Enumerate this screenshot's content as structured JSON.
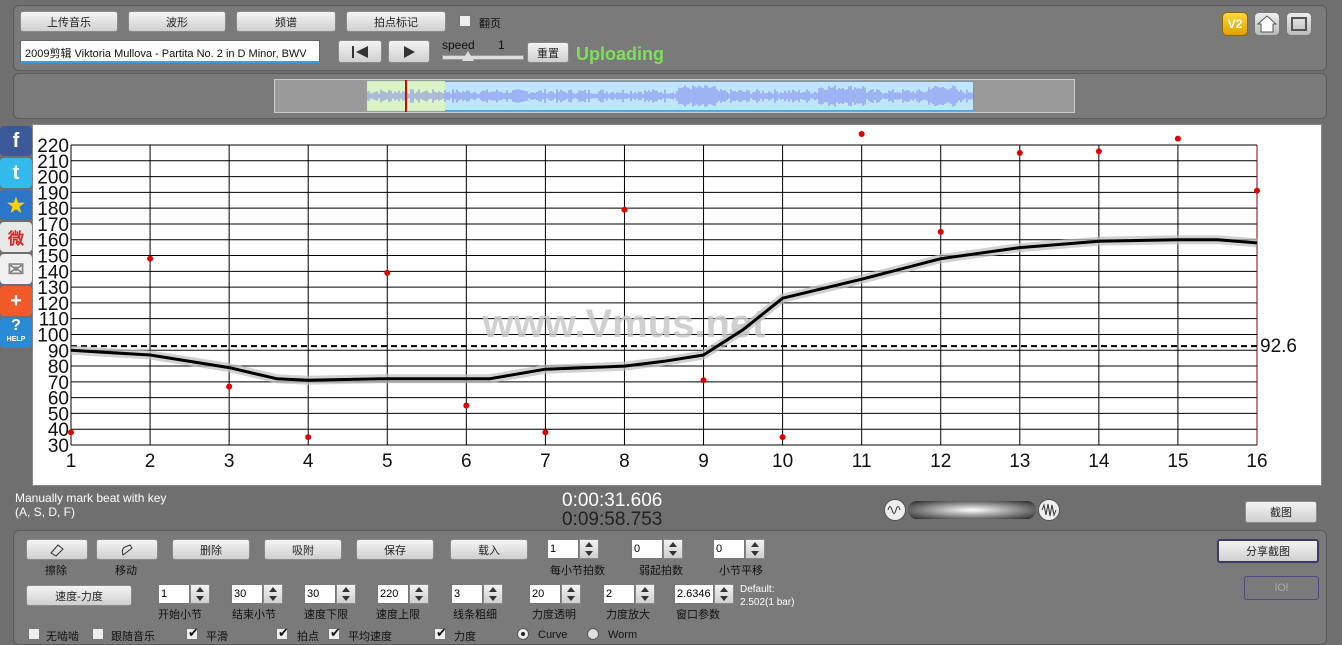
{
  "toolbar": {
    "upload_label": "上传音乐",
    "waveform_label": "波形",
    "spectrum_label": "频谱",
    "beatmark_label": "拍点标记",
    "pageflip_label": "翻页",
    "track_title": "2009剪辑 Viktoria Mullova - Partita No. 2 in D Minor, BWV",
    "speed_label": "speed",
    "speed_value": "1",
    "reset_label": "重置",
    "status_text": "Uploading",
    "v2_badge": "V2"
  },
  "side_share": [
    "f",
    "t",
    "★",
    "微",
    "✉",
    "+",
    "?"
  ],
  "side_help_text": "HELP",
  "chart_data": {
    "type": "line",
    "watermark": "www.Vmus.net",
    "xlim": [
      1,
      16
    ],
    "ylim": [
      30,
      220
    ],
    "x_ticks": [
      "1",
      "2",
      "3",
      "4",
      "5",
      "6",
      "7",
      "8",
      "9",
      "10",
      "11",
      "12",
      "13",
      "14",
      "15",
      "16"
    ],
    "y_ticks": [
      "30",
      "40",
      "50",
      "60",
      "70",
      "80",
      "90",
      "100",
      "110",
      "120",
      "130",
      "140",
      "150",
      "160",
      "170",
      "180",
      "190",
      "200",
      "210",
      "220"
    ],
    "average_value": 92.6,
    "average_label": "92.6",
    "series": [
      {
        "points": [
          [
            1,
            90
          ],
          [
            2,
            87
          ],
          [
            3,
            79
          ],
          [
            3.6,
            72
          ],
          [
            4,
            71
          ],
          [
            5,
            72
          ],
          [
            6,
            72
          ],
          [
            6.3,
            72
          ],
          [
            7,
            78
          ],
          [
            8,
            80
          ],
          [
            8.5,
            83
          ],
          [
            9,
            87
          ],
          [
            9.5,
            103
          ],
          [
            10,
            123
          ],
          [
            11,
            135
          ],
          [
            12,
            148
          ],
          [
            13,
            155
          ],
          [
            14,
            159
          ],
          [
            15,
            160
          ],
          [
            15.5,
            160
          ],
          [
            16,
            158
          ]
        ]
      }
    ],
    "beat_points": [
      [
        1,
        38
      ],
      [
        2,
        148
      ],
      [
        3,
        67
      ],
      [
        4,
        35
      ],
      [
        5,
        139
      ],
      [
        6,
        55
      ],
      [
        7,
        38
      ],
      [
        8,
        179
      ],
      [
        9,
        71
      ],
      [
        10,
        35
      ],
      [
        11,
        227
      ],
      [
        12,
        165
      ],
      [
        13,
        215
      ],
      [
        14,
        216
      ],
      [
        15,
        224
      ],
      [
        16,
        191
      ]
    ]
  },
  "info": {
    "hint_line1": "Manually mark beat with key",
    "hint_line2": "(A, S, D, F)",
    "time_current": "0:00:31.606",
    "time_total": "0:09:58.753",
    "screenshot_label": "截图"
  },
  "controls": {
    "erase_label": "擦除",
    "move_label": "移动",
    "delete_label": "删除",
    "snap_label": "吸附",
    "save_label": "保存",
    "load_label": "载入",
    "beats_per_bar": {
      "label": "每小节拍数",
      "value": "1"
    },
    "weak_beats": {
      "label": "弱起拍数",
      "value": "0"
    },
    "bar_offset": {
      "label": "小节平移",
      "value": "0"
    },
    "share_label": "分享截图",
    "disabled_label": "lOl",
    "tempo_dynamics_label": "速度-力度",
    "start_bar": {
      "label": "开始小节",
      "value": "1"
    },
    "end_bar": {
      "label": "结束小节",
      "value": "30"
    },
    "tempo_lower": {
      "label": "速度下限",
      "value": "30"
    },
    "tempo_upper": {
      "label": "速度上限",
      "value": "220"
    },
    "line_width": {
      "label": "线条粗细",
      "value": "3"
    },
    "dyn_opacity": {
      "label": "力度透明",
      "value": "20"
    },
    "dyn_scale": {
      "label": "力度放大",
      "value": "2"
    },
    "window_param": {
      "label": "窗口参数",
      "value": "2.6346"
    },
    "default_line1": "Default:",
    "default_line2": "2.502(1 bar)",
    "cb_nowrite": "无啮啮",
    "cb_follow": "跟随音乐",
    "cb_smooth": "平滑",
    "cb_beat": "拍点",
    "cb_avg": "平均速度",
    "cb_dyn": "力度",
    "radio_curve": "Curve",
    "radio_worm": "Worm"
  },
  "colors": {
    "beat_dot": "#e00000",
    "uploading": "#7ee05a",
    "panel": "#7a7a7a"
  }
}
